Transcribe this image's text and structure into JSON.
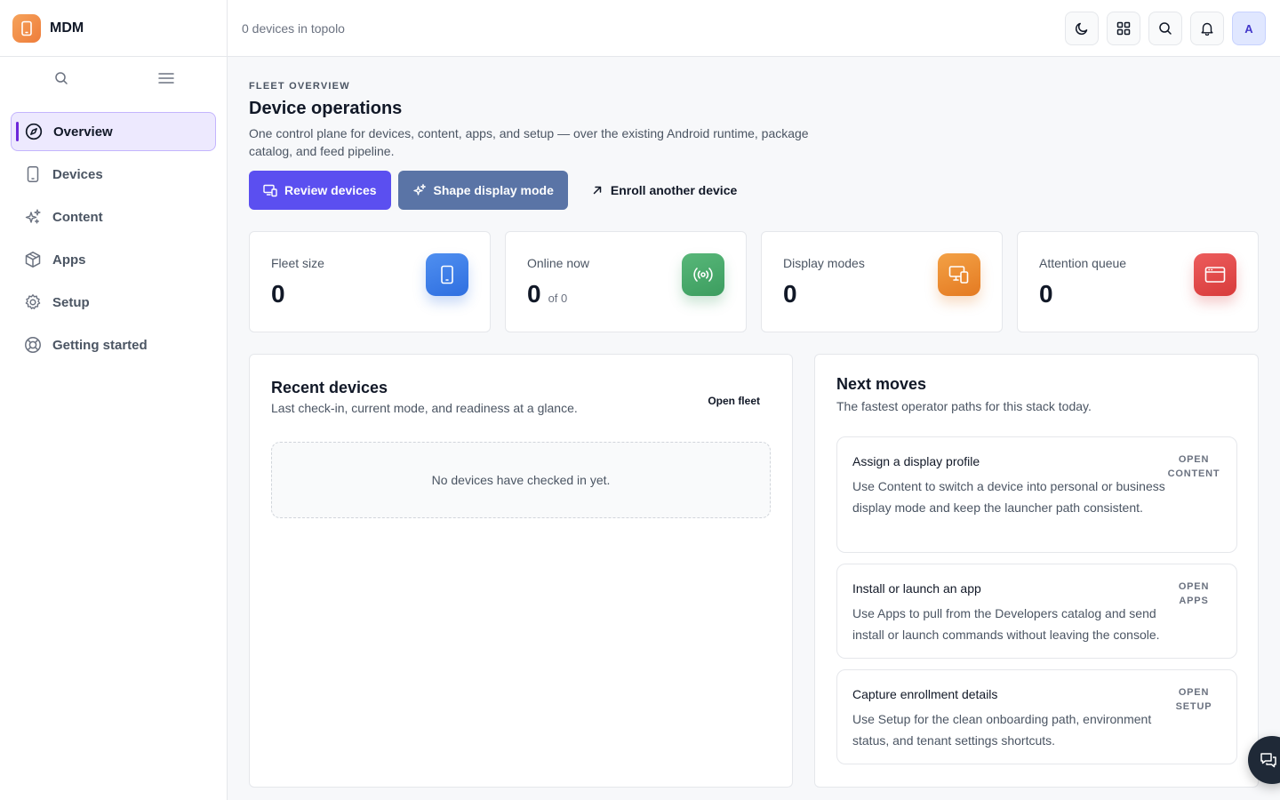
{
  "brand": {
    "name": "MDM"
  },
  "topbar": {
    "status_text": "0 devices in topolo",
    "avatar_initial": "A"
  },
  "sidebar": {
    "items": [
      {
        "label": "Overview",
        "icon": "compass-icon",
        "active": true
      },
      {
        "label": "Devices",
        "icon": "phone-icon"
      },
      {
        "label": "Content",
        "icon": "sparkles-icon"
      },
      {
        "label": "Apps",
        "icon": "box-icon"
      },
      {
        "label": "Setup",
        "icon": "gear-icon"
      },
      {
        "label": "Getting started",
        "icon": "lifebuoy-icon"
      }
    ]
  },
  "header": {
    "eyebrow": "FLEET OVERVIEW",
    "title": "Device operations",
    "description": "One control plane for devices, content, apps, and setup — over the existing Android runtime, package catalog, and feed pipeline."
  },
  "actions": {
    "review_devices": "Review devices",
    "shape_display_mode": "Shape display mode",
    "enroll_device": "Enroll another device"
  },
  "stats": [
    {
      "label": "Fleet size",
      "value": "0",
      "sub": "",
      "icon": "tablet-icon",
      "color": "#2f6fe0"
    },
    {
      "label": "Online now",
      "value": "0",
      "sub": "of 0",
      "icon": "broadcast-icon",
      "color": "#3c9d5f"
    },
    {
      "label": "Display modes",
      "value": "0",
      "sub": "",
      "icon": "monitor-device-icon",
      "color": "#e47a22"
    },
    {
      "label": "Attention queue",
      "value": "0",
      "sub": "",
      "icon": "window-alert-icon",
      "color": "#d83b3b"
    }
  ],
  "recent": {
    "title": "Recent devices",
    "subtitle": "Last check-in, current mode, and readiness at a glance.",
    "open_link": "Open fleet",
    "empty": "No devices have checked in yet."
  },
  "next": {
    "title": "Next moves",
    "subtitle": "The fastest operator paths for this stack today.",
    "moves": [
      {
        "title": "Assign a display profile",
        "desc": "Use Content to switch a device into personal or business display mode and keep the launcher path consistent.",
        "link_line1": "OPEN",
        "link_line2": "CONTENT"
      },
      {
        "title": "Install or launch an app",
        "desc": "Use Apps to pull from the Developers catalog and send install or launch commands without leaving the console.",
        "link_line1": "OPEN",
        "link_line2": "APPS"
      },
      {
        "title": "Capture enrollment details",
        "desc": "Use Setup for the clean onboarding path, environment status, and tenant settings shortcuts.",
        "link_line1": "OPEN",
        "link_line2": "SETUP"
      }
    ]
  },
  "colors": {
    "accent": "#5b4ff0",
    "secondary": "#5a74a6",
    "active_nav_bg": "#ede9fe"
  }
}
